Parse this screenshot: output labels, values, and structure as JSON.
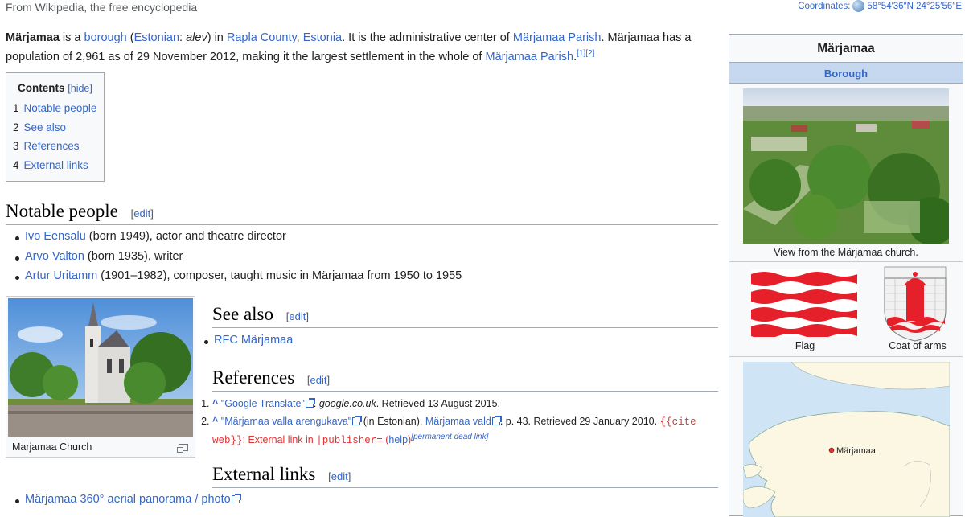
{
  "tagline": "From Wikipedia, the free encyclopedia",
  "coordinates": {
    "label": "Coordinates:",
    "value": "58°54′36″N 24°25′56″E"
  },
  "lead": {
    "line1": [
      "Märjamaa",
      " is a ",
      "borough",
      " (",
      "Estonian",
      ": ",
      "alev",
      ") in ",
      "Rapla County",
      ", ",
      "Estonia",
      ". It is the administrative center of ",
      "Märjamaa Parish",
      ". Märjamaa has a"
    ],
    "line2": [
      "population of 2,961 as of 29 November 2012, making it the largest settlement in the whole of ",
      "Märjamaa Parish",
      ".",
      "[1]",
      "[2]"
    ]
  },
  "toc": {
    "title": "Contents",
    "hide": "[hide]",
    "items": [
      {
        "num": "1",
        "label": "Notable people"
      },
      {
        "num": "2",
        "label": "See also"
      },
      {
        "num": "3",
        "label": "References"
      },
      {
        "num": "4",
        "label": "External links"
      }
    ]
  },
  "edit_label": "edit",
  "sections": {
    "notable": "Notable people",
    "see_also": "See also",
    "references": "References",
    "external": "External links"
  },
  "notable_people": [
    {
      "name": "Ivo Eensalu",
      "desc": " (born 1949), actor and theatre director"
    },
    {
      "name": "Arvo Valton",
      "desc": " (born 1935), writer"
    },
    {
      "name": "Artur Uritamm",
      "desc": " (1901–1982), composer, taught music in Märjamaa from 1950 to 1955"
    }
  ],
  "thumb_caption": "Marjamaa Church",
  "see_also_items": [
    "RFC Märjamaa"
  ],
  "references": [
    {
      "caret": "^",
      "title": "\"Google Translate\"",
      "site": "google.co.uk",
      "rest": ". Retrieved 13 August 2015."
    },
    {
      "caret": "^",
      "title": "\"Märjamaa valla arengukava\"",
      "lang": " (in Estonian). ",
      "publisher": "Märjamaa vald",
      "rest": ". p. 43. Retrieved 29 January 2010. ",
      "cite_open": "{{cite",
      "cite_web": "web}}",
      "err": ": External link in ",
      "param": "|publisher=",
      "help": "help",
      "dead": "[permanent dead link]"
    }
  ],
  "external_links": [
    "Märjamaa 360° aerial panorama / photo"
  ],
  "infobox": {
    "title": "Märjamaa",
    "type": "Borough",
    "photo_caption": "View from the Märjamaa church.",
    "flag_caption": "Flag",
    "arms_caption": "Coat of arms",
    "map_label": "Märjamaa"
  },
  "colors": {
    "link": "#3366cc",
    "error": "#d33",
    "flag_red": "#e5202a"
  }
}
